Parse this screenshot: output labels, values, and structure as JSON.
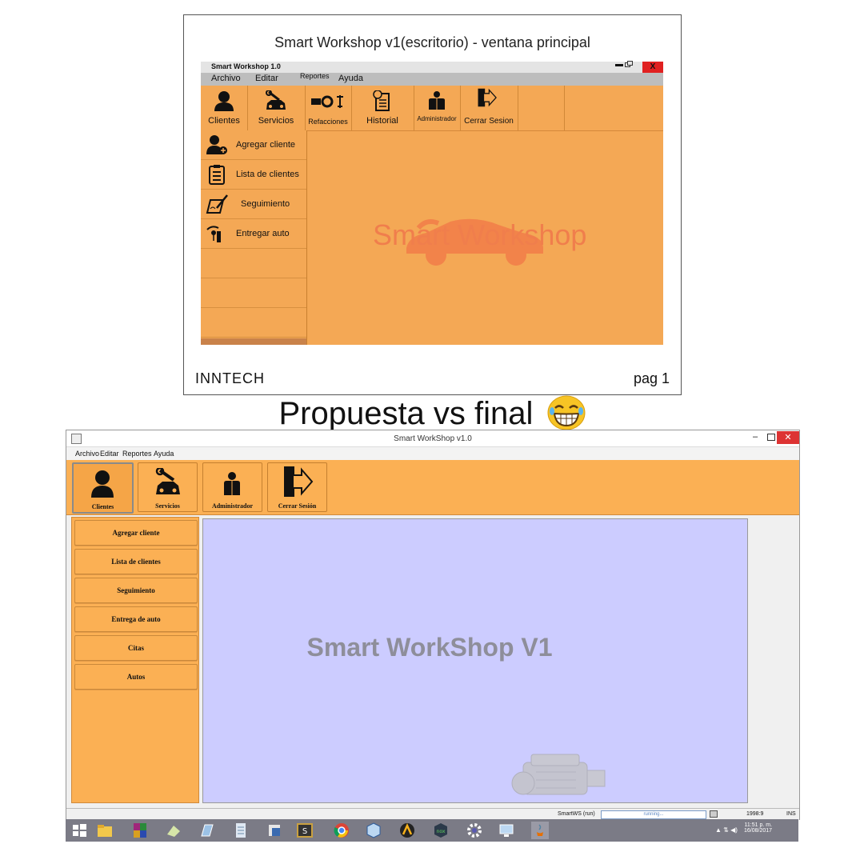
{
  "mockup": {
    "heading": "Smart Workshop v1(escritorio) - ventana principal",
    "window_title": "Smart Workshop 1.0",
    "close_label": "X",
    "menu": [
      "Archivo",
      "Editar",
      "Reportes",
      "Ayuda"
    ],
    "toolbar": [
      "Clientes",
      "Servicios",
      "Refacciones",
      "Historial",
      "Administrador",
      "Cerrar Sesion"
    ],
    "sidebar": [
      "Agregar cliente",
      "Lista de clientes",
      "Seguimiento",
      "Entregar auto"
    ],
    "watermark": "Smart Workshop",
    "footer_left": "INNTECH",
    "footer_right": "pag 1"
  },
  "caption": "Propuesta vs final",
  "final": {
    "window_title": "Smart WorkShop v1.0",
    "menu": [
      "Archivo",
      "Editar",
      "Reportes",
      "Ayuda"
    ],
    "toolbar": [
      "Clientes",
      "Servicios",
      "Administrador",
      "Cerrar Sesión"
    ],
    "sidebar": [
      "Agregar cliente",
      "Lista de clientes",
      "Seguimiento",
      "Entrega de auto",
      "Citas",
      "Autos"
    ],
    "watermark": "Smart WorkShop V1",
    "status": {
      "task": "SmartWS (run)",
      "progress_text": "running...",
      "position": "1998:9",
      "mode": "INS"
    }
  },
  "taskbar": {
    "time": "11:51 p. m.",
    "date": "16/08/2017"
  },
  "colors": {
    "orange": "#f4a855",
    "final_orange": "#fbb054",
    "content_lavender": "#ccccff",
    "close_red": "#e02020"
  }
}
